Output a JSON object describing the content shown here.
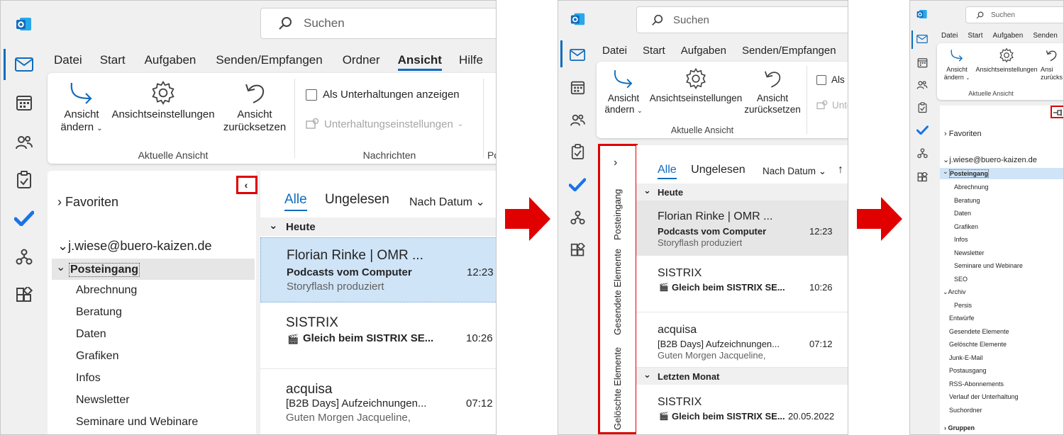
{
  "search_placeholder": "Suchen",
  "menu": {
    "datei": "Datei",
    "start": "Start",
    "aufgaben": "Aufgaben",
    "senden": "Senden/Empfangen",
    "ordner": "Ordner",
    "ansicht": "Ansicht",
    "hilfe": "Hilfe",
    "senden_cut": "Senden"
  },
  "ribbon": {
    "ansicht_aendern_1": "Ansicht",
    "ansicht_aendern_2": "ändern",
    "ansichtseinstellungen": "Ansichtseinstellungen",
    "zuruecksetzen_1": "Ansicht",
    "zuruecksetzen_2": "zurücksetzen",
    "group_aktuelle_ansicht": "Aktuelle Ansicht",
    "als_unterhaltungen": "Als Unterhaltungen anzeigen",
    "als_unterhaltungen_cut": "Als U",
    "unterhaltungseinstellungen": "Unterhaltungseinstellungen",
    "unterhaltungseinstellungen_cut": "Unte",
    "group_nachrichten": "Nachrichten",
    "group_po_cut": "Po",
    "ansicht_cut": "Ansi",
    "zurueck_cut": "zurücks"
  },
  "nav": {
    "favoriten": "Favoriten",
    "account": "j.wiese@buero-kaizen.de",
    "posteingang": "Posteingang",
    "folders": [
      "Abrechnung",
      "Beratung",
      "Daten",
      "Grafiken",
      "Infos",
      "Newsletter",
      "Seminare und Webinare"
    ],
    "folders_full": [
      "Abrechnung",
      "Beratung",
      "Daten",
      "Grafiken",
      "Infos",
      "Newsletter",
      "Seminare und Webinare",
      "SEO"
    ],
    "archiv": "Archiv",
    "persis": "Persis",
    "other": [
      "Entwürfe",
      "Gesendete Elemente",
      "Gelöschte Elemente",
      "Junk-E-Mail",
      "Postausgang",
      "RSS-Abonnements",
      "Verlauf der Unterhaltung",
      "Suchordner"
    ],
    "gruppen": "Gruppen",
    "collapsed": [
      "Posteingang",
      "Gesendete Elemente",
      "Gelöschte Elemente"
    ]
  },
  "list": {
    "tab_all": "Alle",
    "tab_unread": "Ungelesen",
    "sort": "Nach Datum",
    "today": "Heute",
    "last_month": "Letzten Monat",
    "mails": [
      {
        "from": "Florian Rinke | OMR ...",
        "subject": "Podcasts vom Computer",
        "preview": "Storyflash produziert",
        "time": "12:23"
      },
      {
        "from": "SISTRIX",
        "subject": "Gleich beim SISTRIX SE...",
        "preview": "",
        "time": "10:26"
      },
      {
        "from": "acquisa",
        "subject": "[B2B Days] Aufzeichnungen...",
        "preview": "Guten Morgen Jacqueline,",
        "time": "07:12"
      },
      {
        "from": "SISTRIX",
        "subject": "Gleich beim SISTRIX SE...",
        "preview": "",
        "time": "20.05.2022"
      }
    ]
  },
  "colors": {
    "accent": "#0f6cbd",
    "highlight": "#e00000",
    "selected_mail": "#cfe4f7"
  }
}
